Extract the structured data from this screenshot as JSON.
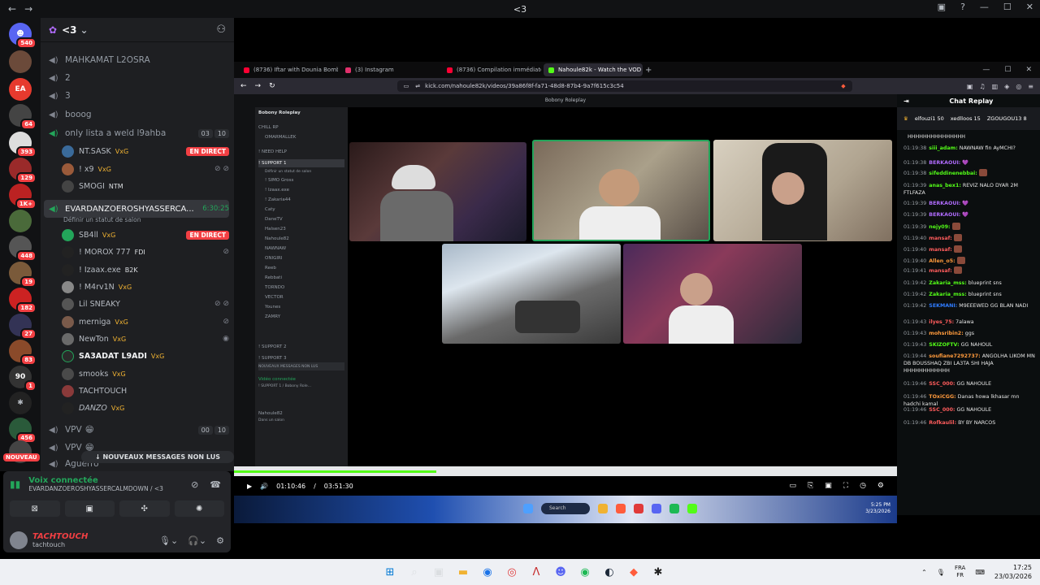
{
  "window": {
    "title": "<3"
  },
  "guild_badges": [
    "540",
    "64",
    "393",
    "129",
    "1K+",
    "448",
    "19",
    "182",
    "27",
    "83",
    "1",
    "456",
    "NOUVEAU"
  ],
  "sidebar": {
    "server_name": "<3",
    "channels": [
      {
        "name": "MAHKAMAT L2OSRA"
      },
      {
        "name": "2"
      },
      {
        "name": "3"
      },
      {
        "name": "booog"
      },
      {
        "name": "only lista a weld l9ahba",
        "count_a": "03",
        "count_b": "10"
      }
    ],
    "members_1": [
      {
        "name": "NT.SASK",
        "tag": "VxG",
        "live": "EN DIRECT"
      },
      {
        "name": "! x9",
        "tag": "VxG"
      },
      {
        "name": "SMOGI",
        "tag": "NTM"
      }
    ],
    "active_channel": {
      "name": "EVARDANZOEROSHYASSERCA...",
      "time": "6:30:25",
      "status": "Définir un statut de salon"
    },
    "members_2": [
      {
        "name": "SB4ll",
        "tag": "VxG",
        "live": "EN DIRECT"
      },
      {
        "name": "! MOROX 777",
        "tag": "FDI"
      },
      {
        "name": "! Izaax.exe",
        "tag": "B2K"
      },
      {
        "name": "! M4rv1N",
        "tag": "VxG"
      },
      {
        "name": "Lil SNEAKY",
        "tag": ""
      },
      {
        "name": "merniga",
        "tag": "VxG"
      },
      {
        "name": "NewTon",
        "tag": "VxG"
      },
      {
        "name": "SA3ADAT L9ADI",
        "tag": "VxG"
      },
      {
        "name": "smooks",
        "tag": "VxG"
      },
      {
        "name": "TACHTOUCH",
        "tag": ""
      },
      {
        "name": "DANZO",
        "tag": "VxG"
      }
    ],
    "channels_after": [
      {
        "name": "VPV",
        "count_a": "00",
        "count_b": "10"
      },
      {
        "name": "VPV"
      },
      {
        "name": "Aguerro"
      }
    ],
    "new_messages": "NOUVEAUX MESSAGES NON LUS"
  },
  "voice": {
    "title": "Voix connectée",
    "channel": "EVARDANZOEROSHYASSERCALMDOWN / <3"
  },
  "user": {
    "name": "TACHTOUCH",
    "handle": "tachtouch"
  },
  "browser": {
    "tabs": [
      {
        "title": "(8736) Iftar with Dounia Bomba ✨ -",
        "color": "#ff0033"
      },
      {
        "title": "(3) Instagram",
        "color": "#e1306c"
      },
      {
        "title": "(8736) Compilation immédiate : juge",
        "color": "#ff0033"
      },
      {
        "title": "Nahoule82k - Watch the VOD on K",
        "color": "#53fc18"
      }
    ],
    "url": "kick.com/nahoule82k/videos/39a86f8f-fa71-48d8-87b4-9a7f615c3c54"
  },
  "player": {
    "inner_title": "Bobony Roleplay",
    "current_time": "01:10:46",
    "duration": "03:51:30",
    "progress": 0.305,
    "search_placeholder": "Search",
    "inner_clock_time": "5:25 PM",
    "inner_clock_date": "3/23/2026"
  },
  "inner_discord": {
    "server": "Bobony Roleplay",
    "items": [
      {
        "label": "CHILL RP"
      },
      {
        "label": "OMARMALLEK"
      },
      {
        "label": "! NEED HELP"
      },
      {
        "label": "! SUPPORT 1"
      },
      {
        "label": "Définir un statut de salon"
      },
      {
        "label": "! SIMO Gross"
      },
      {
        "label": "! Izaax.exe"
      },
      {
        "label": "! Zakaria44"
      },
      {
        "label": "Caty"
      },
      {
        "label": "DaneTV"
      },
      {
        "label": "Halsen23"
      },
      {
        "label": "Nahoule82"
      },
      {
        "label": "NAWNAW"
      },
      {
        "label": "ONIGIRI"
      },
      {
        "label": "Reeb"
      },
      {
        "label": "Rebbati"
      },
      {
        "label": "TORNDO"
      },
      {
        "label": "VECTOR"
      },
      {
        "label": "Younes"
      },
      {
        "label": "ZAMRY"
      },
      {
        "label": "! SUPPORT 2"
      },
      {
        "label": "! SUPPORT 3"
      },
      {
        "label": "NOUVEAUX MESSAGES NON LUS"
      },
      {
        "label": "Vidéo connectée"
      },
      {
        "label": "! SUPPORT 1 / Bobony Role..."
      },
      {
        "label": "Nahoule82"
      },
      {
        "label": "Dans un salon"
      }
    ]
  },
  "chat": {
    "title": "Chat Replay",
    "pinned": [
      {
        "name": "elfouzi1",
        "value": "50"
      },
      {
        "name": "xedlloos",
        "value": "15"
      },
      {
        "name": "ZGOUGOU13",
        "value": "8"
      }
    ],
    "messages": [
      {
        "time": "",
        "user": "",
        "color": "#ffffff",
        "text": "HHHHHHHHHHHHHHH"
      },
      {
        "time": "01:19:38",
        "user": "siii_adam:",
        "color": "#53fc18",
        "text": "NAWNAW fin AyMCHI?"
      },
      {
        "time": "01:19:38",
        "user": "BERKAOUI:",
        "color": "#b16cff",
        "text": "💜"
      },
      {
        "time": "01:19:38",
        "user": "sifeddinenebbai:",
        "color": "#53fc18",
        "text": ""
      },
      {
        "time": "01:19:39",
        "user": "anas_bex1:",
        "color": "#53fc18",
        "text": "REVIZ NALO DYAR 2M FTLFAZA"
      },
      {
        "time": "01:19:39",
        "user": "BERKAOUI:",
        "color": "#b16cff",
        "text": "💜"
      },
      {
        "time": "01:19:39",
        "user": "BERKAOUI:",
        "color": "#b16cff",
        "text": "💜"
      },
      {
        "time": "01:19:39",
        "user": "nejy09:",
        "color": "#53fc18",
        "text": ""
      },
      {
        "time": "01:19:40",
        "user": "mansaf:",
        "color": "#ff5c5c",
        "text": ""
      },
      {
        "time": "01:19:40",
        "user": "mansaf:",
        "color": "#ff5c5c",
        "text": ""
      },
      {
        "time": "01:19:40",
        "user": "Allen_o5:",
        "color": "#ff9a3c",
        "text": ""
      },
      {
        "time": "01:19:41",
        "user": "mansaf:",
        "color": "#ff5c5c",
        "text": ""
      },
      {
        "time": "01:19:42",
        "user": "Zakaria_mss:",
        "color": "#53fc18",
        "text": "blueprint sns"
      },
      {
        "time": "01:19:42",
        "user": "Zakaria_mss:",
        "color": "#53fc18",
        "text": "blueprint sns"
      },
      {
        "time": "01:19:42",
        "user": "SEKMANI:",
        "color": "#2f7cff",
        "text": "M9EEEWED GG BLAN NADI"
      },
      {
        "time": "01:19:43",
        "user": "ilyes_75:",
        "color": "#ff5c5c",
        "text": "7alawa"
      },
      {
        "time": "01:19:43",
        "user": "mohsribin2:",
        "color": "#ff9a3c",
        "text": "ggs"
      },
      {
        "time": "01:19:43",
        "user": "SKIZOFTV:",
        "color": "#53fc18",
        "text": "GG NAHOUL"
      },
      {
        "time": "01:19:44",
        "user": "soufiane7292737:",
        "color": "#ff9a3c",
        "text": "ANGOLHA LIKOM MN DB BOUSSHAQ ZBI LA3TA SHI HAJA HHHHHHHHHHHH"
      },
      {
        "time": "01:19:46",
        "user": "SSC_000:",
        "color": "#ff5c5c",
        "text": "GG NAHOULE"
      },
      {
        "time": "01:19:46",
        "user": "TOxiCGG:",
        "color": "#ff9a3c",
        "text": "Danas howa lkhasar mn hadchi kamal"
      },
      {
        "time": "01:19:46",
        "user": "SSC_000:",
        "color": "#ff5c5c",
        "text": "GG NAHOULE"
      },
      {
        "time": "01:19:46",
        "user": "Rofkaulil:",
        "color": "#ff5c5c",
        "text": "BY BY NARCOS"
      }
    ]
  },
  "taskbar": {
    "lang_top": "FRA",
    "lang_bottom": "FR",
    "time": "17:25",
    "date": "23/03/2026"
  }
}
